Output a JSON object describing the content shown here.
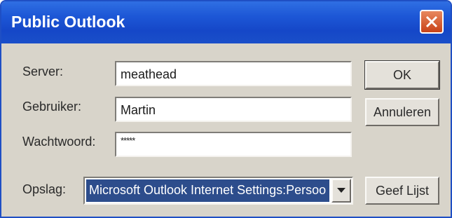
{
  "window": {
    "title": "Public Outlook",
    "close_icon": "close-icon"
  },
  "form": {
    "server_label": "Server:",
    "server_value": "meathead",
    "user_label": "Gebruiker:",
    "user_value": "Martin",
    "password_label": "Wachtwoord:",
    "password_value": "*****",
    "storage_label": "Opslag:",
    "storage_value": "Microsoft Outlook Internet Settings:Persoo"
  },
  "buttons": {
    "ok": "OK",
    "cancel": "Annuleren",
    "list": "Geef Lijst"
  },
  "colors": {
    "titlebar": "#1d57d6",
    "selection": "#2d4d8c",
    "close": "#d9552b"
  }
}
